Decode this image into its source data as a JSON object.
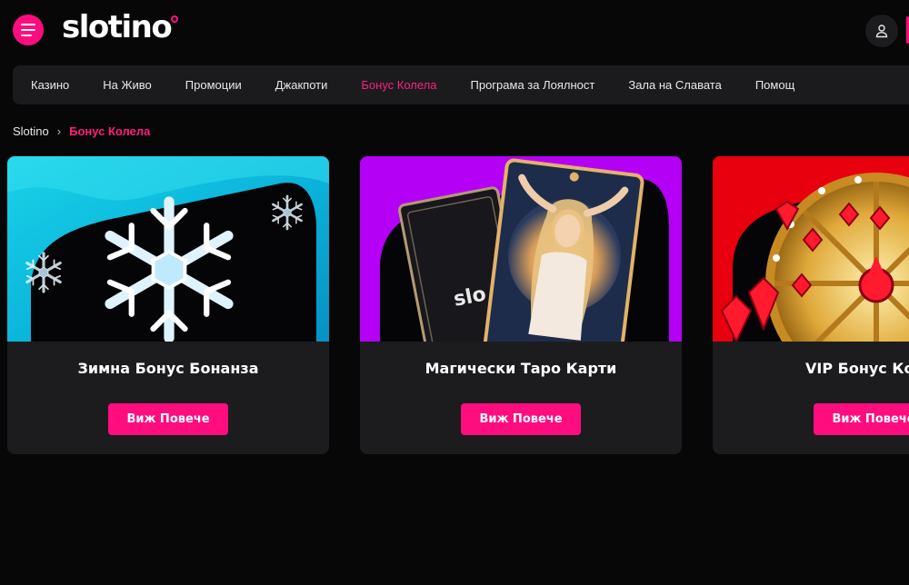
{
  "brand": {
    "logo_text": "slotino",
    "accent": "#ff0d7f"
  },
  "header": {
    "menu_icon": "hamburger-icon",
    "user_icon": "user-icon"
  },
  "nav": {
    "items": [
      {
        "label": "Казино"
      },
      {
        "label": "На Живо"
      },
      {
        "label": "Промоции"
      },
      {
        "label": "Джакпоти"
      },
      {
        "label": "Бонус Колела",
        "active": true
      },
      {
        "label": "Програма за Лоялност"
      },
      {
        "label": "Зала на Славата"
      },
      {
        "label": "Помощ"
      }
    ]
  },
  "breadcrumb": {
    "home": "Slotino",
    "separator": "›",
    "current": "Бонус Колела"
  },
  "cards": [
    {
      "title": "Зимна Бонус Бонанза",
      "button": "Виж Повече",
      "image": "snowflake-banner"
    },
    {
      "title": "Магически Таро Карти",
      "button": "Виж Повече",
      "image": "tarot-cards-banner",
      "card_logo_text": "slo"
    },
    {
      "title": "VIP Бонус Колело",
      "button": "Виж Повече",
      "image": "golden-wheel-banner"
    }
  ]
}
